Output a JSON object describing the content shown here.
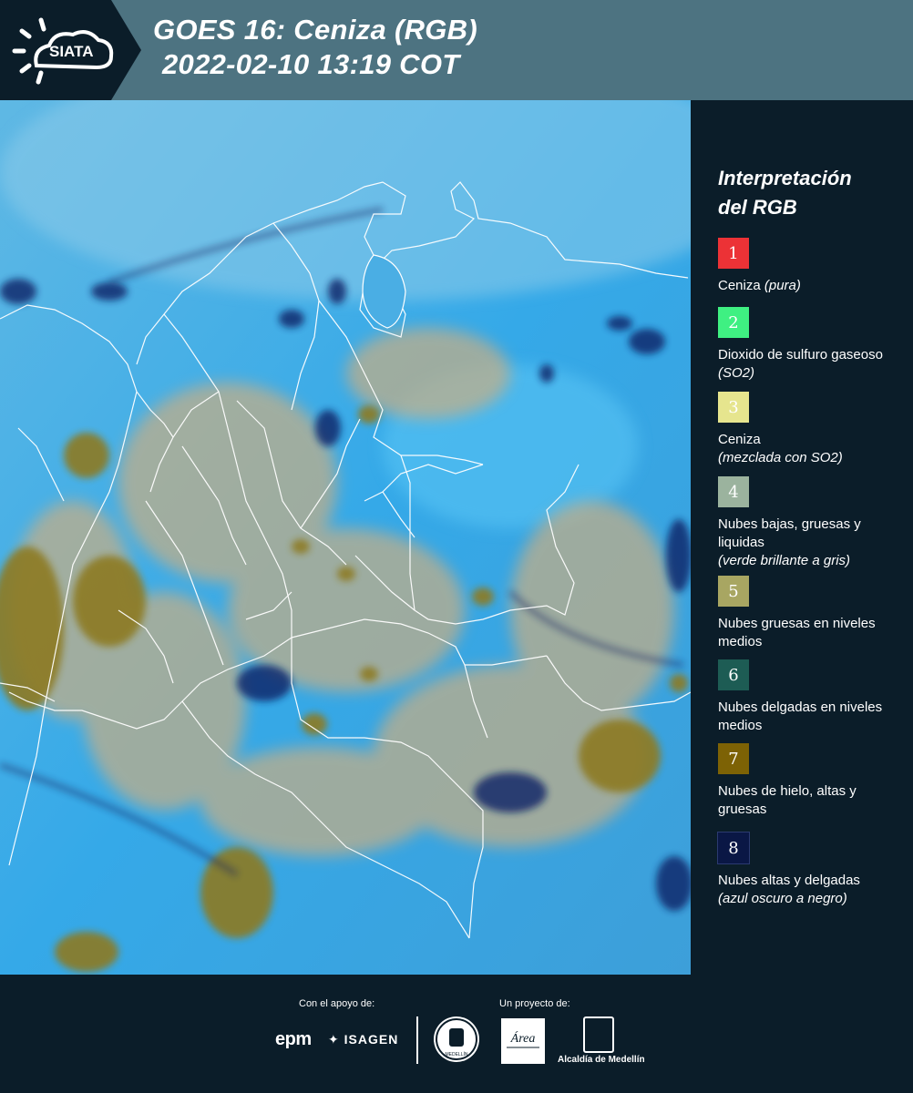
{
  "header": {
    "logo_text": "SIATA",
    "title_line1": "GOES 16: Ceniza (RGB)",
    "title_line2": "2022-02-10 13:19 COT"
  },
  "legend": {
    "title_line1": "Interpretación",
    "title_line2": "del RGB",
    "items": [
      {
        "number": "1",
        "color": "#ec3236",
        "label": "Ceniza",
        "note": "(pura)"
      },
      {
        "number": "2",
        "color": "#3ff082",
        "label": "Dioxido de sulfuro gaseoso",
        "note": "(SO2)"
      },
      {
        "number": "3",
        "color": "#e6e58e",
        "label": "Ceniza",
        "note": "(mezclada con SO2)"
      },
      {
        "number": "4",
        "color": "#9bb39e",
        "label": "Nubes bajas, gruesas y liquidas",
        "note": "(verde brillante a gris)"
      },
      {
        "number": "5",
        "color": "#a8a662",
        "label": "Nubes gruesas en niveles medios",
        "note": ""
      },
      {
        "number": "6",
        "color": "#1d5c54",
        "label": "Nubes delgadas en niveles medios",
        "note": ""
      },
      {
        "number": "7",
        "color": "#7d6205",
        "label": "Nubes de hielo, altas y gruesas",
        "note": ""
      },
      {
        "number": "8",
        "color": "#0a1745",
        "label": "Nubes altas y delgadas",
        "note": "(azul oscuro a negro)"
      }
    ]
  },
  "footer": {
    "support_label": "Con el apoyo de:",
    "project_label": "Un proyecto de:",
    "epm": "epm",
    "isagen": "ISAGEN",
    "alcaldia": "Alcaldía de Medellín",
    "area_logo_text": "Área",
    "seal_text": "MEDELLÍN"
  }
}
